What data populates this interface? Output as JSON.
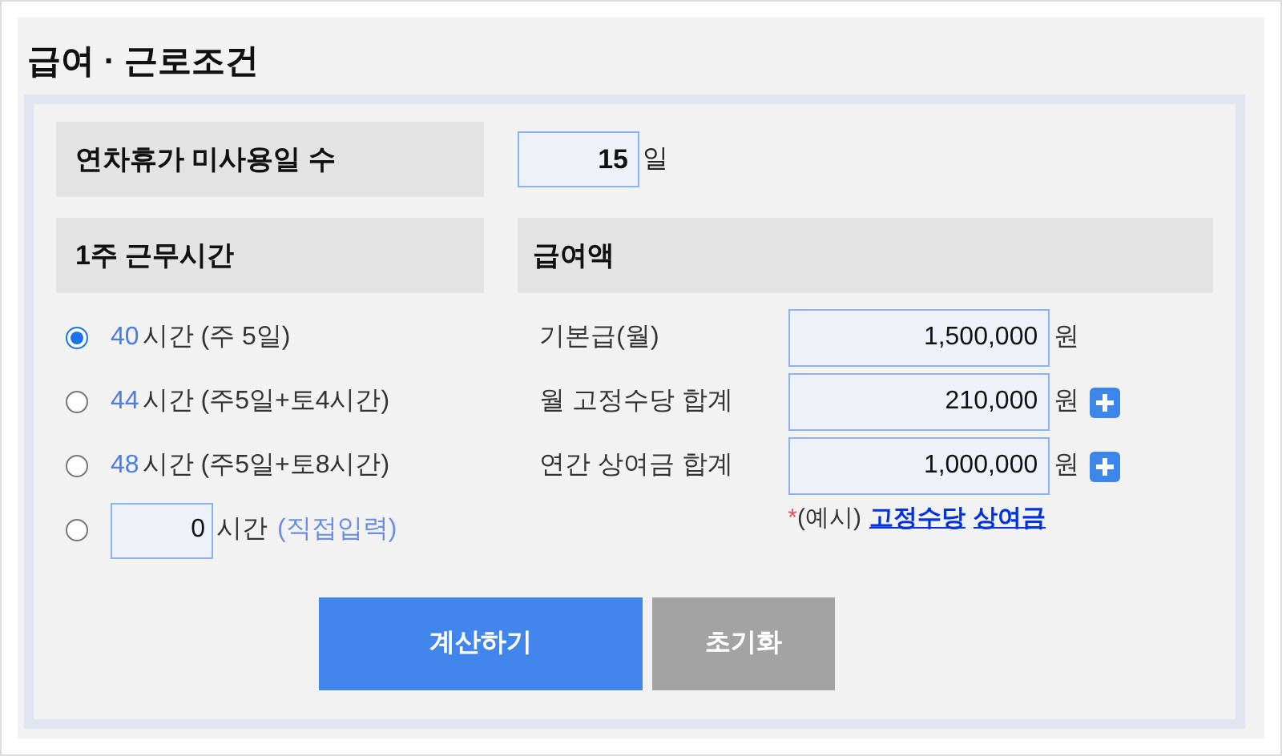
{
  "title": "급여 · 근로조건",
  "leave": {
    "label": "연차휴가 미사용일 수",
    "value": "15",
    "unit": "일"
  },
  "hours": {
    "heading": "1주 근무시간",
    "options": [
      {
        "kind": "preset",
        "hours": "40",
        "unit": "시간",
        "detail": "(주 5일)",
        "selected": true
      },
      {
        "kind": "preset",
        "hours": "44",
        "unit": "시간",
        "detail": "(주5일+토4시간)",
        "selected": false
      },
      {
        "kind": "preset",
        "hours": "48",
        "unit": "시간",
        "detail": "(주5일+토8시간)",
        "selected": false
      },
      {
        "kind": "custom",
        "value": "0",
        "unit": "시간",
        "detail": "(직접입력)",
        "selected": false
      }
    ]
  },
  "pay": {
    "heading": "급여액",
    "rows": [
      {
        "label": "기본급(월)",
        "value": "1,500,000",
        "unit": "원",
        "addable": false
      },
      {
        "label": "월 고정수당 합계",
        "value": "210,000",
        "unit": "원",
        "addable": true
      },
      {
        "label": "연간 상여금 합계",
        "value": "1,000,000",
        "unit": "원",
        "addable": true
      }
    ],
    "note": {
      "mark": "*",
      "text": "(예시)",
      "links": [
        "고정수당",
        "상여금"
      ]
    }
  },
  "buttons": [
    {
      "kind": "primary",
      "label": "계산하기"
    },
    {
      "kind": "secondary",
      "label": "초기화"
    }
  ]
}
